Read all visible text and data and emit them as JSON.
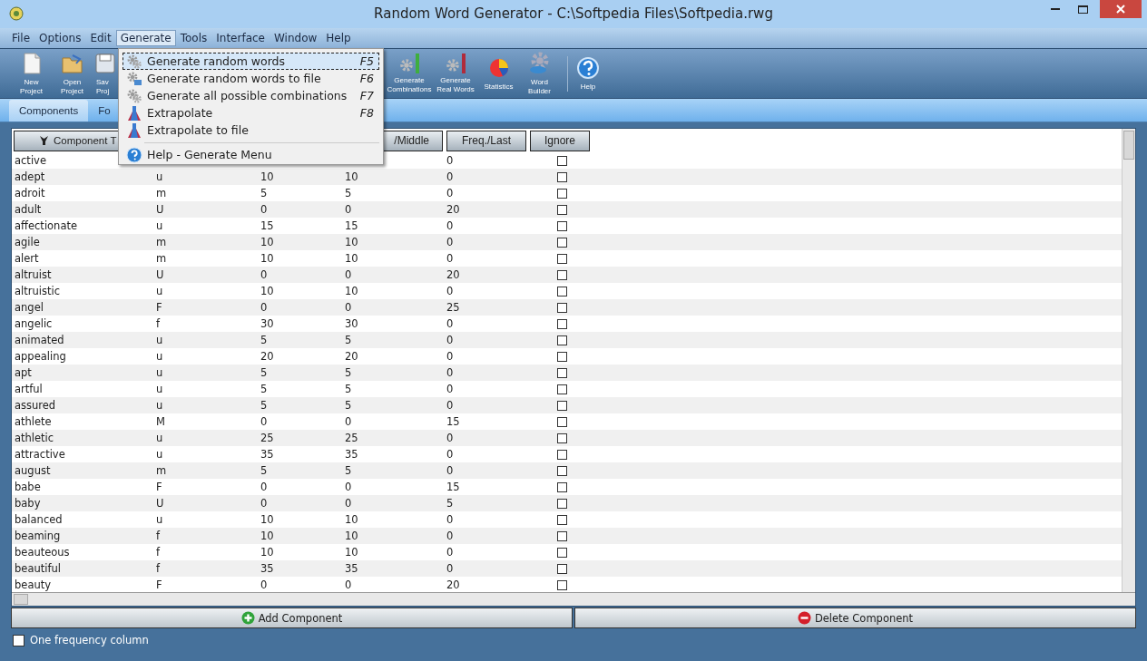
{
  "window": {
    "title": "Random Word Generator - C:\\Softpedia Files\\Softpedia.rwg"
  },
  "menu_bar": [
    {
      "label": "File",
      "selected": false
    },
    {
      "label": "Options",
      "selected": false
    },
    {
      "label": "Edit",
      "selected": false
    },
    {
      "label": "Generate",
      "selected": true
    },
    {
      "label": "Tools",
      "selected": false
    },
    {
      "label": "Interface",
      "selected": false
    },
    {
      "label": "Window",
      "selected": false
    },
    {
      "label": "Help",
      "selected": false
    }
  ],
  "toolbar": [
    {
      "lines": [
        "New",
        "Project"
      ],
      "kind": "new"
    },
    {
      "lines": [
        "Open",
        "Project"
      ],
      "kind": "open"
    },
    {
      "lines": [
        "Sav",
        "Proj"
      ],
      "kind": "save"
    },
    {
      "lines": [
        "Generate",
        "Combinations"
      ],
      "kind": "abc"
    },
    {
      "lines": [
        "Generate",
        "Real Words"
      ],
      "kind": "cat"
    },
    {
      "lines": [
        "Statistics"
      ],
      "kind": "pie"
    },
    {
      "lines": [
        "Word",
        "Builder"
      ],
      "kind": "builder"
    },
    {
      "lines": [
        "Help"
      ],
      "kind": "help"
    }
  ],
  "tabs": [
    {
      "label": "Components",
      "selected": true
    },
    {
      "label": "Fo",
      "selected": false
    }
  ],
  "columns": [
    {
      "label": "Component T"
    },
    {
      "label": "/Middle"
    },
    {
      "label": "Freq./Last"
    },
    {
      "label": "Ignore"
    }
  ],
  "rows": [
    {
      "cells": [
        "active",
        null,
        null,
        null,
        "0"
      ],
      "ignored": false
    },
    {
      "cells": [
        "adept",
        "u",
        "10",
        "10",
        "0"
      ],
      "ignored": false
    },
    {
      "cells": [
        "adroit",
        "m",
        "5",
        "5",
        "0"
      ],
      "ignored": false
    },
    {
      "cells": [
        "adult",
        "U",
        "0",
        "0",
        "20"
      ],
      "ignored": false
    },
    {
      "cells": [
        "affectionate",
        "u",
        "15",
        "15",
        "0"
      ],
      "ignored": false
    },
    {
      "cells": [
        "agile",
        "m",
        "10",
        "10",
        "0"
      ],
      "ignored": false
    },
    {
      "cells": [
        "alert",
        "m",
        "10",
        "10",
        "0"
      ],
      "ignored": false
    },
    {
      "cells": [
        "altruist",
        "U",
        "0",
        "0",
        "20"
      ],
      "ignored": false
    },
    {
      "cells": [
        "altruistic",
        "u",
        "10",
        "10",
        "0"
      ],
      "ignored": false
    },
    {
      "cells": [
        "angel",
        "F",
        "0",
        "0",
        "25"
      ],
      "ignored": false
    },
    {
      "cells": [
        "angelic",
        "f",
        "30",
        "30",
        "0"
      ],
      "ignored": false
    },
    {
      "cells": [
        "animated",
        "u",
        "5",
        "5",
        "0"
      ],
      "ignored": false
    },
    {
      "cells": [
        "appealing",
        "u",
        "20",
        "20",
        "0"
      ],
      "ignored": false
    },
    {
      "cells": [
        "apt",
        "u",
        "5",
        "5",
        "0"
      ],
      "ignored": false
    },
    {
      "cells": [
        "artful",
        "u",
        "5",
        "5",
        "0"
      ],
      "ignored": false
    },
    {
      "cells": [
        "assured",
        "u",
        "5",
        "5",
        "0"
      ],
      "ignored": false
    },
    {
      "cells": [
        "athlete",
        "M",
        "0",
        "0",
        "15"
      ],
      "ignored": false
    },
    {
      "cells": [
        "athletic",
        "u",
        "25",
        "25",
        "0"
      ],
      "ignored": false
    },
    {
      "cells": [
        "attractive",
        "u",
        "35",
        "35",
        "0"
      ],
      "ignored": false
    },
    {
      "cells": [
        "august",
        "m",
        "5",
        "5",
        "0"
      ],
      "ignored": false
    },
    {
      "cells": [
        "babe",
        "F",
        "0",
        "0",
        "15"
      ],
      "ignored": false
    },
    {
      "cells": [
        "baby",
        "U",
        "0",
        "0",
        "5"
      ],
      "ignored": false
    },
    {
      "cells": [
        "balanced",
        "u",
        "10",
        "10",
        "0"
      ],
      "ignored": false
    },
    {
      "cells": [
        "beaming",
        "f",
        "10",
        "10",
        "0"
      ],
      "ignored": false
    },
    {
      "cells": [
        "beauteous",
        "f",
        "10",
        "10",
        "0"
      ],
      "ignored": false
    },
    {
      "cells": [
        "beautiful",
        "f",
        "35",
        "35",
        "0"
      ],
      "ignored": false
    },
    {
      "cells": [
        "beauty",
        "F",
        "0",
        "0",
        "20"
      ],
      "ignored": false
    }
  ],
  "buttons": [
    {
      "label": "Add Component",
      "kind": "add"
    },
    {
      "label": "Delete Component",
      "kind": "delete"
    }
  ],
  "one_frequency_column": {
    "label": "One frequency column",
    "checked": false
  },
  "generate_menu": [
    {
      "label": "Generate random words",
      "shortcut": "F5",
      "kind": "gears",
      "selected": true
    },
    {
      "label": "Generate random words to file",
      "shortcut": "F6",
      "kind": "gears-file",
      "selected": false
    },
    {
      "label": "Generate all possible combinations",
      "shortcut": "F7",
      "kind": "gears",
      "selected": false
    },
    {
      "label": "Extrapolate",
      "shortcut": "F8",
      "kind": "extrapolate",
      "selected": false
    },
    {
      "label": "Extrapolate to file",
      "kind": "extrapolate",
      "selected": false
    },
    {
      "kind": "separator"
    },
    {
      "label": "Help - Generate Menu",
      "kind": "help",
      "selected": false
    }
  ]
}
